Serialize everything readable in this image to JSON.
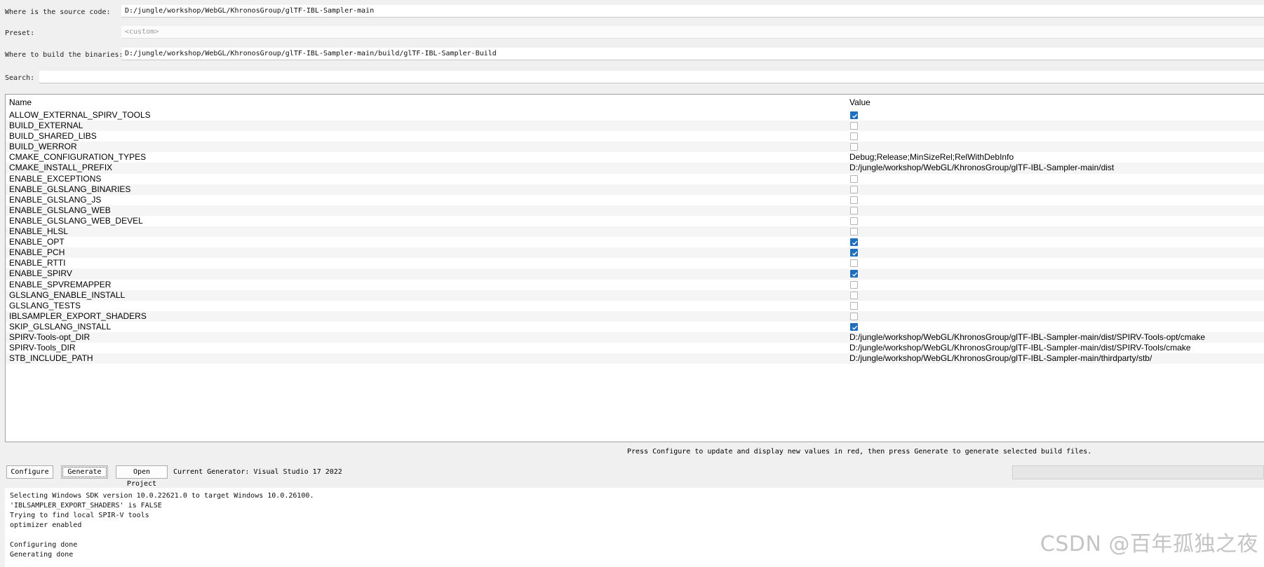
{
  "source": {
    "label": "Where is the source code:",
    "value": "D:/jungle/workshop/WebGL/KhronosGroup/glTF-IBL-Sampler-main"
  },
  "preset": {
    "label": "Preset:",
    "value": "<custom>"
  },
  "build": {
    "label": "Where to build the binaries:",
    "value": "D:/jungle/workshop/WebGL/KhronosGroup/glTF-IBL-Sampler-main/build/glTF-IBL-Sampler-Build"
  },
  "search": {
    "label": "Search:",
    "value": ""
  },
  "table": {
    "name_header": "Name",
    "value_header": "Value",
    "rows": [
      {
        "name": "ALLOW_EXTERNAL_SPIRV_TOOLS",
        "type": "bool",
        "checked": true
      },
      {
        "name": "BUILD_EXTERNAL",
        "type": "bool",
        "checked": false
      },
      {
        "name": "BUILD_SHARED_LIBS",
        "type": "bool",
        "checked": false
      },
      {
        "name": "BUILD_WERROR",
        "type": "bool",
        "checked": false
      },
      {
        "name": "CMAKE_CONFIGURATION_TYPES",
        "type": "text",
        "value": "Debug;Release;MinSizeRel;RelWithDebInfo"
      },
      {
        "name": "CMAKE_INSTALL_PREFIX",
        "type": "text",
        "value": "D:/jungle/workshop/WebGL/KhronosGroup/glTF-IBL-Sampler-main/dist"
      },
      {
        "name": "ENABLE_EXCEPTIONS",
        "type": "bool",
        "checked": false
      },
      {
        "name": "ENABLE_GLSLANG_BINARIES",
        "type": "bool",
        "checked": false
      },
      {
        "name": "ENABLE_GLSLANG_JS",
        "type": "bool",
        "checked": false
      },
      {
        "name": "ENABLE_GLSLANG_WEB",
        "type": "bool",
        "checked": false
      },
      {
        "name": "ENABLE_GLSLANG_WEB_DEVEL",
        "type": "bool",
        "checked": false
      },
      {
        "name": "ENABLE_HLSL",
        "type": "bool",
        "checked": false
      },
      {
        "name": "ENABLE_OPT",
        "type": "bool",
        "checked": true
      },
      {
        "name": "ENABLE_PCH",
        "type": "bool",
        "checked": true
      },
      {
        "name": "ENABLE_RTTI",
        "type": "bool",
        "checked": false
      },
      {
        "name": "ENABLE_SPIRV",
        "type": "bool",
        "checked": true
      },
      {
        "name": "ENABLE_SPVREMAPPER",
        "type": "bool",
        "checked": false
      },
      {
        "name": "GLSLANG_ENABLE_INSTALL",
        "type": "bool",
        "checked": false
      },
      {
        "name": "GLSLANG_TESTS",
        "type": "bool",
        "checked": false
      },
      {
        "name": "IBLSAMPLER_EXPORT_SHADERS",
        "type": "bool",
        "checked": false
      },
      {
        "name": "SKIP_GLSLANG_INSTALL",
        "type": "bool",
        "checked": true
      },
      {
        "name": "SPIRV-Tools-opt_DIR",
        "type": "text",
        "value": "D:/jungle/workshop/WebGL/KhronosGroup/glTF-IBL-Sampler-main/dist/SPIRV-Tools-opt/cmake"
      },
      {
        "name": "SPIRV-Tools_DIR",
        "type": "text",
        "value": "D:/jungle/workshop/WebGL/KhronosGroup/glTF-IBL-Sampler-main/dist/SPIRV-Tools/cmake"
      },
      {
        "name": "STB_INCLUDE_PATH",
        "type": "text",
        "value": "D:/jungle/workshop/WebGL/KhronosGroup/glTF-IBL-Sampler-main/thirdparty/stb/"
      }
    ]
  },
  "hint": "Press Configure to update and display new values in red, then press Generate to generate selected build files.",
  "buttons": {
    "configure": "Configure",
    "generate": "Generate",
    "open_project": "Open Project"
  },
  "generator": "Current Generator: Visual Studio 17 2022",
  "output": [
    "Selecting Windows SDK version 10.0.22621.0 to target Windows 10.0.26100.",
    "'IBLSAMPLER_EXPORT_SHADERS' is FALSE",
    "Trying to find local SPIR-V tools",
    "optimizer enabled",
    "",
    "Configuring done",
    "Generating done"
  ],
  "watermark": "CSDN @百年孤独之夜",
  "colors": {
    "check_accent": "#1f6fbf",
    "background": "#f0f0f0"
  }
}
